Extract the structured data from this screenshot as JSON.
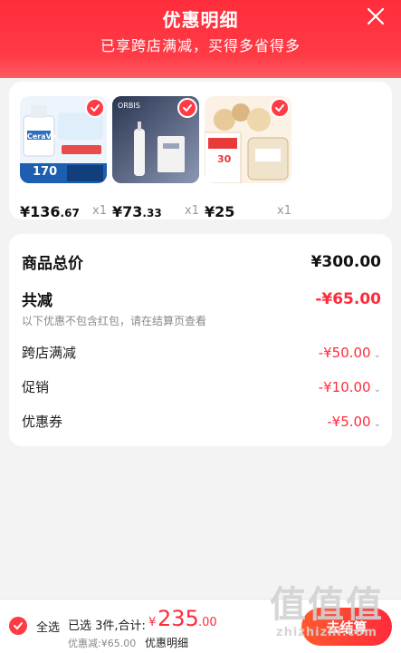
{
  "header": {
    "title": "优惠明细",
    "subtitle": "已享跨店满减，买得多省得多"
  },
  "products": [
    {
      "price_int": "¥136",
      "price_dec": ".67",
      "qty": "x1",
      "thumb_text": "CeraVe",
      "badge_text": "170"
    },
    {
      "price_int": "¥73",
      "price_dec": ".33",
      "qty": "x1",
      "thumb_text": "ORBIS",
      "badge_text": ""
    },
    {
      "price_int": "¥25",
      "price_dec": "",
      "qty": "x1",
      "thumb_text": "30",
      "badge_text": "30"
    }
  ],
  "summary": {
    "total_label": "商品总价",
    "total_value": "¥300.00",
    "reduce_label": "共减",
    "reduce_value": "-¥65.00",
    "note": "以下优惠不包含红包，请在结算页查看",
    "items": [
      {
        "label": "跨店满减",
        "value": "-¥50.00"
      },
      {
        "label": "促销",
        "value": "-¥10.00"
      },
      {
        "label": "优惠券",
        "value": "-¥5.00"
      }
    ]
  },
  "bottom": {
    "select_all": "全选",
    "selected_text": "已选 3件,合计:",
    "currency": "¥",
    "amount": "235",
    "decimal": ".00",
    "discount": "优惠减:¥65.00",
    "detail_link": "优惠明细",
    "checkout": "去结算"
  },
  "watermark": {
    "logo": "值值值",
    "url": "zhizhizhi.com"
  },
  "colors": {
    "accent": "#ff2d3b",
    "text": "#222222"
  }
}
